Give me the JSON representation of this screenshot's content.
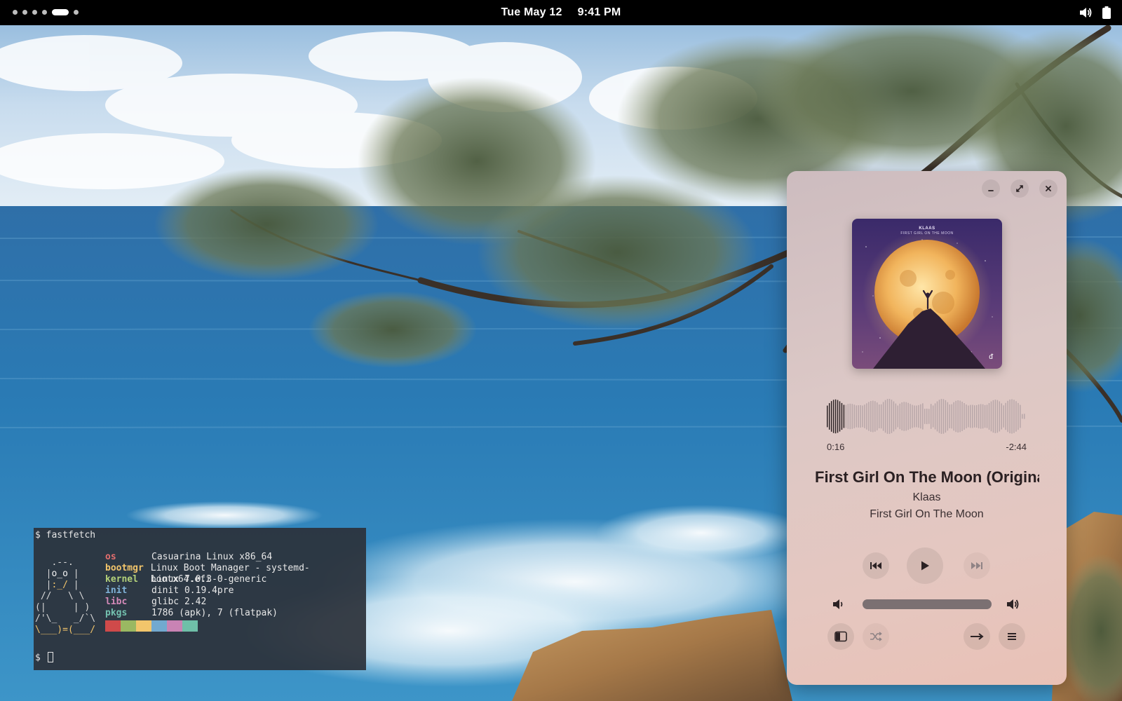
{
  "topbar": {
    "workspaces": [
      {
        "active": false
      },
      {
        "active": false
      },
      {
        "active": false
      },
      {
        "active": false
      },
      {
        "active": true
      },
      {
        "active": false
      }
    ],
    "date": "Tue May 12",
    "time": "9:41 PM",
    "tray_icons": [
      "volume-icon",
      "battery-icon"
    ]
  },
  "terminal": {
    "command_line": "$ fastfetch",
    "prompt": "$",
    "info": [
      {
        "key": "os",
        "value": "Casuarina Linux x86_64",
        "color": "#e36e6e"
      },
      {
        "key": "bootmgr",
        "value": "Linux Boot Manager - systemd-bootx64.efi",
        "color": "#f2c56b"
      },
      {
        "key": "kernel",
        "value": "Linux 7.0.3-0-generic",
        "color": "#b4d27a"
      },
      {
        "key": "init",
        "value": "dinit 0.19.4pre",
        "color": "#7fb2d8"
      },
      {
        "key": "libc",
        "value": "glibc 2.42",
        "color": "#d48ab9"
      },
      {
        "key": "pkgs",
        "value": "1786 (apk), 7 (flatpak)",
        "color": "#74c2b0"
      }
    ],
    "palette": [
      "#cf4a4a",
      "#9ab862",
      "#f2c56b",
      "#72a9cf",
      "#c983b4",
      "#6fbfa8"
    ]
  },
  "player": {
    "window_buttons": [
      "minimize-icon",
      "maximize-icon",
      "close-icon"
    ],
    "album_art": {
      "artist_text": "KLAAS",
      "title_text": "FIRST GIRL ON THE MOON"
    },
    "progress": {
      "elapsed": "0:16",
      "remaining": "-2:44",
      "fraction": 0.09
    },
    "track": {
      "title": "First Girl On The Moon (Original Mix)",
      "artist": "Klaas",
      "album": "First Girl On The Moon"
    },
    "controls": [
      "previous-icon",
      "play-icon",
      "next-icon"
    ],
    "volume": {
      "level": 1.0
    },
    "bottom_controls": [
      "sidebar-icon",
      "shuffle-icon",
      "repeat-icon",
      "queue-icon"
    ]
  }
}
